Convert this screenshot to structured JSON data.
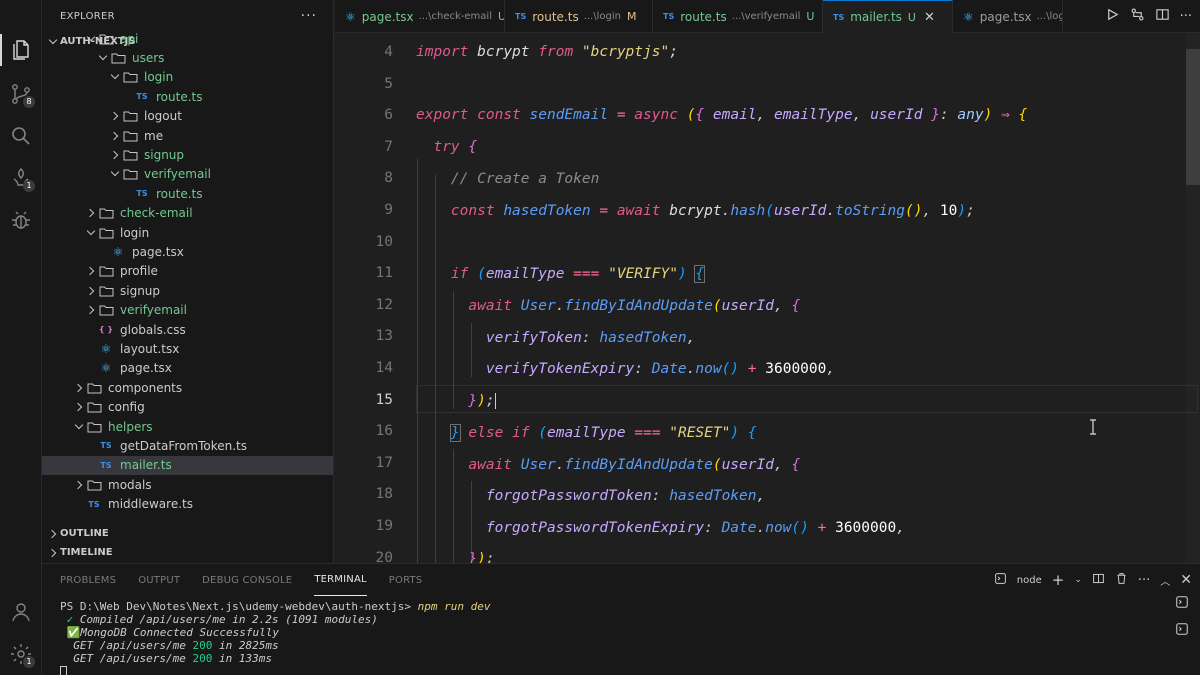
{
  "sidebar": {
    "title": "EXPLORER",
    "more": "···",
    "root": "AUTH-NEXTJS",
    "items": [
      {
        "label": "api",
        "type": "folder",
        "open": true,
        "depth": 3,
        "green": true
      },
      {
        "label": "users",
        "type": "folder",
        "open": true,
        "depth": 4,
        "green": true
      },
      {
        "label": "login",
        "type": "folder",
        "open": true,
        "depth": 5,
        "green": true
      },
      {
        "label": "route.ts",
        "type": "ts",
        "depth": 6,
        "green": true
      },
      {
        "label": "logout",
        "type": "folder",
        "open": false,
        "depth": 5
      },
      {
        "label": "me",
        "type": "folder",
        "open": false,
        "depth": 5
      },
      {
        "label": "signup",
        "type": "folder",
        "open": false,
        "depth": 5,
        "green": true
      },
      {
        "label": "verifyemail",
        "type": "folder",
        "open": true,
        "depth": 5,
        "green": true
      },
      {
        "label": "route.ts",
        "type": "ts",
        "depth": 6,
        "green": true
      },
      {
        "label": "check-email",
        "type": "folder",
        "open": false,
        "depth": 3,
        "green": true
      },
      {
        "label": "login",
        "type": "folder",
        "open": true,
        "depth": 3
      },
      {
        "label": "page.tsx",
        "type": "react",
        "depth": 4
      },
      {
        "label": "profile",
        "type": "folder",
        "open": false,
        "depth": 3
      },
      {
        "label": "signup",
        "type": "folder",
        "open": false,
        "depth": 3
      },
      {
        "label": "verifyemail",
        "type": "folder",
        "open": false,
        "depth": 3,
        "green": true
      },
      {
        "label": "globals.css",
        "type": "css",
        "depth": 3
      },
      {
        "label": "layout.tsx",
        "type": "react",
        "depth": 3
      },
      {
        "label": "page.tsx",
        "type": "react",
        "depth": 3
      },
      {
        "label": "components",
        "type": "folder",
        "open": false,
        "depth": 2
      },
      {
        "label": "config",
        "type": "folder",
        "open": false,
        "depth": 2
      },
      {
        "label": "helpers",
        "type": "folder",
        "open": true,
        "depth": 2,
        "green": true
      },
      {
        "label": "getDataFromToken.ts",
        "type": "ts",
        "depth": 3
      },
      {
        "label": "mailer.ts",
        "type": "ts",
        "depth": 3,
        "green": true,
        "selected": true
      },
      {
        "label": "modals",
        "type": "folder",
        "open": false,
        "depth": 2
      },
      {
        "label": "middleware.ts",
        "type": "ts",
        "depth": 2
      }
    ],
    "outline": "OUTLINE",
    "timeline": "TIMELINE"
  },
  "activity": {
    "source_control_badge": "8",
    "extensions_badge": "1",
    "settings_badge": "1"
  },
  "tabs": [
    {
      "icon": "react",
      "name": "page.tsx",
      "desc": "...\\check-email",
      "status": "U",
      "state": "untr"
    },
    {
      "icon": "TS",
      "name": "route.ts",
      "desc": "...\\login",
      "status": "M",
      "state": "mod"
    },
    {
      "icon": "TS",
      "name": "route.ts",
      "desc": "...\\verifyemail",
      "status": "U",
      "state": "untr"
    },
    {
      "icon": "TS",
      "name": "mailer.ts",
      "desc": "",
      "status": "U",
      "state": "untr",
      "active": true
    },
    {
      "icon": "react",
      "name": "page.tsx",
      "desc": "...\\login",
      "status": "",
      "state": ""
    }
  ],
  "editor": {
    "line_numbers": [
      "4",
      "5",
      "6",
      "7",
      "8",
      "9",
      "10",
      "11",
      "12",
      "13",
      "14",
      "15",
      "16",
      "17",
      "18",
      "19",
      "20"
    ],
    "current_line": "15"
  },
  "panel": {
    "tabs": [
      "PROBLEMS",
      "OUTPUT",
      "DEBUG CONSOLE",
      "TERMINAL",
      "PORTS"
    ],
    "active_tab": "TERMINAL",
    "shell": "node",
    "terminal": {
      "prompt": "PS D:\\Web Dev\\Notes\\Next.js\\udemy-webdev\\auth-nextjs>",
      "command": "npm run dev",
      "compiled_check": "✓",
      "compiled": "Compiled /api/users/me in 2.2s (1091 modules)",
      "db_check": "✅",
      "db": "MongoDB Connected Successfully",
      "get1_path": "GET /api/users/me",
      "get1_status": "200",
      "get1_time": "in 2825ms",
      "get2_path": "GET /api/users/me",
      "get2_status": "200",
      "get2_time": "in 133ms"
    }
  },
  "colors": {
    "accent": "#0078d4",
    "untracked": "#73c991",
    "modified": "#e2c08d",
    "keyword": "#e05a8f",
    "string": "#e4d37d",
    "function": "#5c9df5",
    "variable": "#c6a9ff"
  }
}
